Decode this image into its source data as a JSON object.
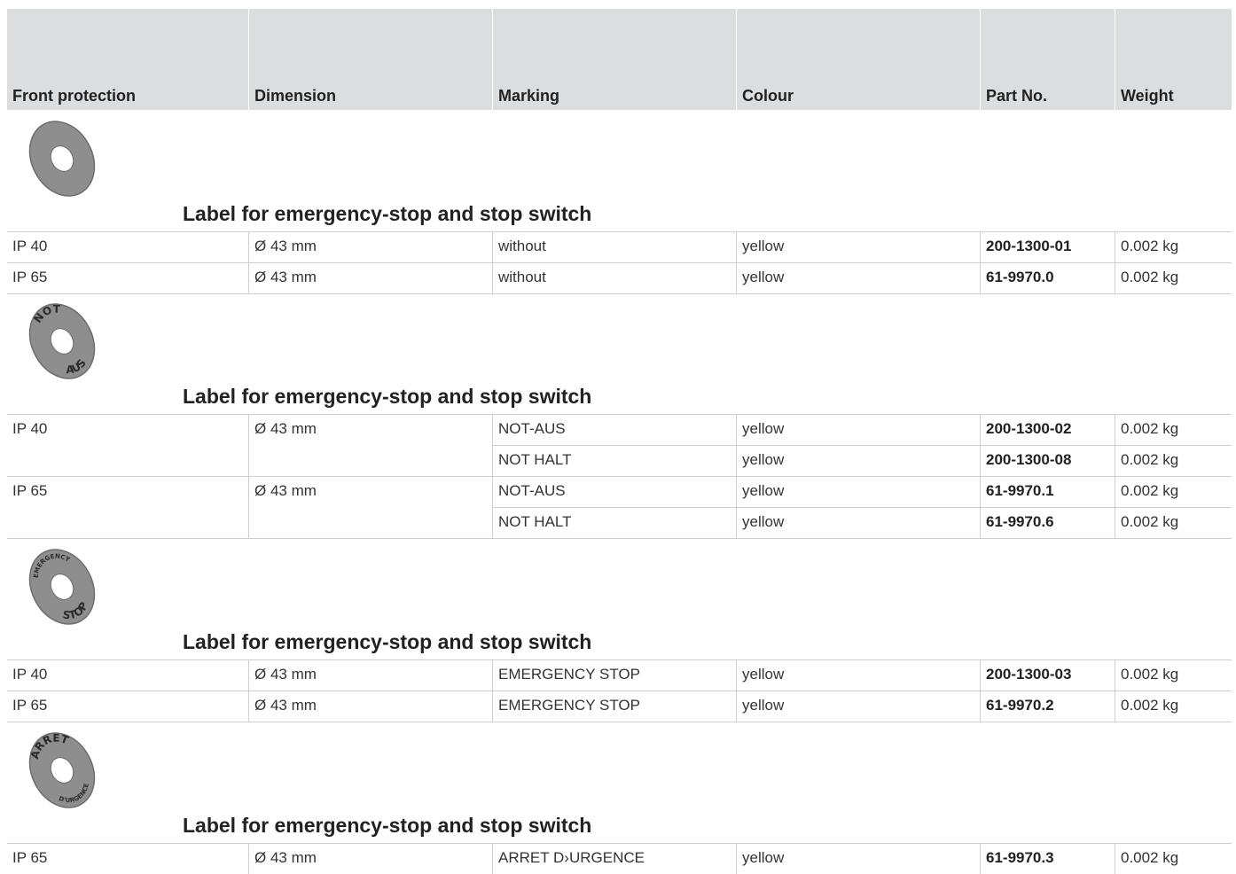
{
  "headers": [
    "Front protection",
    "Dimension",
    "Marking",
    "Colour",
    "Part No.",
    "Weight"
  ],
  "sections": [
    {
      "title": "Label for emergency-stop and stop switch",
      "image_text": [
        "",
        ""
      ],
      "rows": [
        [
          "IP 40",
          "Ø 43 mm",
          "without",
          "yellow",
          "200-1300-01",
          "0.002 kg"
        ],
        [
          "IP 65",
          "Ø 43 mm",
          "without",
          "yellow",
          "61-9970.0",
          "0.002 kg"
        ]
      ]
    },
    {
      "title": "Label for emergency-stop and stop switch",
      "image_text": [
        "NOT",
        "AUS"
      ],
      "rows": [
        [
          "IP 40",
          "Ø 43 mm",
          "NOT-AUS",
          "yellow",
          "200-1300-02",
          "0.002 kg"
        ],
        [
          "",
          "",
          "NOT HALT",
          "yellow",
          "200-1300-08",
          "0.002 kg"
        ],
        [
          "IP 65",
          "Ø 43 mm",
          "NOT-AUS",
          "yellow",
          "61-9970.1",
          "0.002 kg"
        ],
        [
          "",
          "",
          "NOT HALT",
          "yellow",
          "61-9970.6",
          "0.002 kg"
        ]
      ]
    },
    {
      "title": "Label for emergency-stop and stop switch",
      "image_text": [
        "EMERGENCY",
        "STOP"
      ],
      "rows": [
        [
          "IP 40",
          "Ø 43 mm",
          "EMERGENCY STOP",
          "yellow",
          "200-1300-03",
          "0.002 kg"
        ],
        [
          "IP 65",
          "Ø 43 mm",
          "EMERGENCY STOP",
          "yellow",
          "61-9970.2",
          "0.002 kg"
        ]
      ]
    },
    {
      "title": "Label for emergency-stop and stop switch",
      "image_text": [
        "ARRET",
        "D'URGENCE"
      ],
      "rows": [
        [
          "IP 65",
          "Ø 43 mm",
          "ARRET D›URGENCE",
          "yellow",
          "61-9970.3",
          "0.002 kg"
        ]
      ]
    }
  ],
  "colors": {
    "header_bg": "#dcdddf",
    "grid": "#cfd0d2",
    "label_disc": "#8e8e8e"
  }
}
